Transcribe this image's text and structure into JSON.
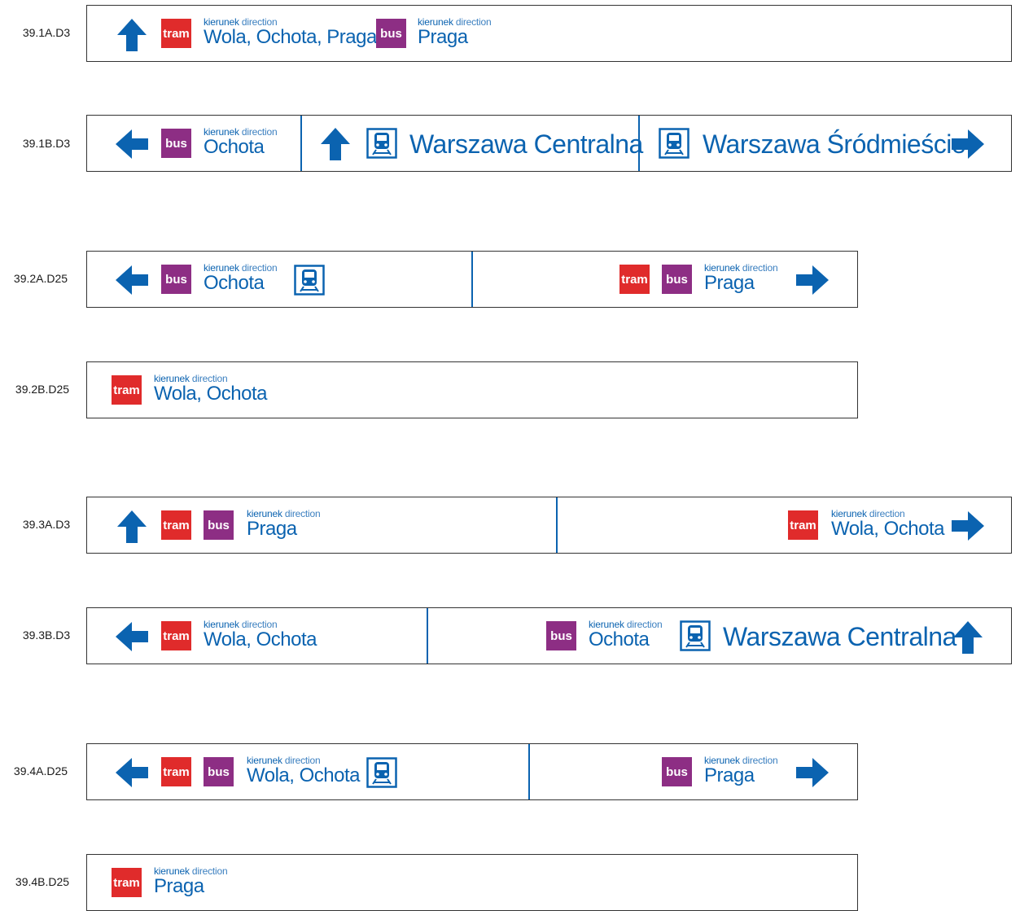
{
  "colors": {
    "blue": "#0b63b0",
    "tram": "#e02b2b",
    "bus": "#8d2e84",
    "border": "#333333"
  },
  "labels": {
    "kierunek": "kierunek",
    "direction": "direction",
    "tram": "tram",
    "bus": "bus"
  },
  "icons": [
    "arrow-up-icon",
    "arrow-left-icon",
    "arrow-right-icon",
    "train-icon"
  ],
  "signs": [
    {
      "code": "39.1A.D3",
      "destinations": [
        "Wola, Ochota, Praga",
        "Praga"
      ]
    },
    {
      "code": "39.1B.D3",
      "destinations": [
        "Ochota",
        "Warszawa Centralna",
        "Warszawa Śródmieście"
      ]
    },
    {
      "code": "39.2A.D25",
      "destinations": [
        "Ochota",
        "Praga"
      ]
    },
    {
      "code": "39.2B.D25",
      "destinations": [
        "Wola, Ochota"
      ]
    },
    {
      "code": "39.3A.D3",
      "destinations": [
        "Praga",
        "Wola, Ochota"
      ]
    },
    {
      "code": "39.3B.D3",
      "destinations": [
        "Wola, Ochota",
        "Ochota",
        "Warszawa Centralna"
      ]
    },
    {
      "code": "39.4A.D25",
      "destinations": [
        "Wola, Ochota",
        "Praga"
      ]
    },
    {
      "code": "39.4B.D25",
      "destinations": [
        "Praga"
      ]
    }
  ]
}
